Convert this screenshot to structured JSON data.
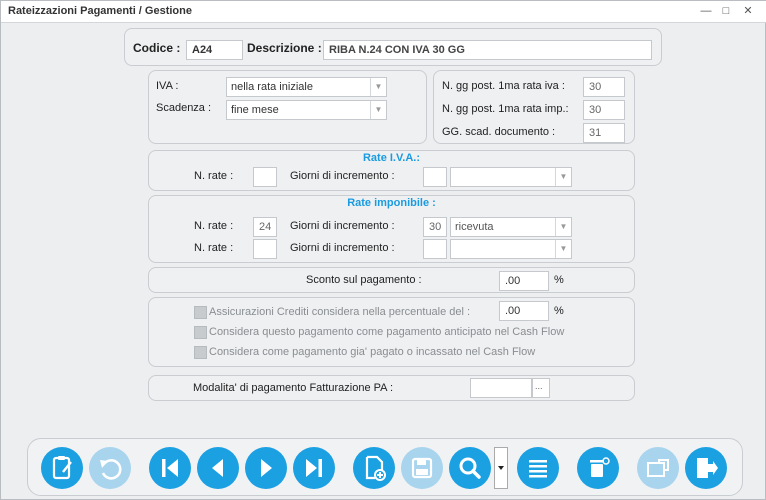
{
  "window": {
    "title": "Rateizzazioni Pagamenti / Gestione"
  },
  "header": {
    "codice_label": "Codice :",
    "codice_value": "A24",
    "descrizione_label": "Descrizione :",
    "descrizione_value": "RIBA N.24 CON IVA 30 GG"
  },
  "options": {
    "iva_label": "IVA :",
    "iva_value": "nella rata iniziale",
    "scadenza_label": "Scadenza :",
    "scadenza_value": "fine mese",
    "gg_post_iva_label": "N. gg post. 1ma rata iva :",
    "gg_post_iva_value": "30",
    "gg_post_imp_label": "N. gg post. 1ma rata imp.:",
    "gg_post_imp_value": "30",
    "gg_scad_label": "GG. scad. documento :",
    "gg_scad_value": "31"
  },
  "rate_iva": {
    "title": "Rate I.V.A.:",
    "n_rate_label": "N. rate :",
    "n_rate_value": "",
    "giorni_label": "Giorni  di incremento :",
    "giorni_value": "",
    "tipo_value": ""
  },
  "rate_imponibile": {
    "title": "Rate imponibile :",
    "rows": [
      {
        "n_rate_label": "N. rate :",
        "n_rate_value": "24",
        "giorni_label": "Giorni  di incremento :",
        "giorni_value": "30",
        "tipo_value": "ricevuta"
      },
      {
        "n_rate_label": "N. rate :",
        "n_rate_value": "",
        "giorni_label": "Giorni  di incremento :",
        "giorni_value": "",
        "tipo_value": ""
      }
    ]
  },
  "sconto": {
    "label": "Sconto sul pagamento :",
    "value": ".00",
    "unit": "%"
  },
  "assicurazioni": {
    "label": "Assicurazioni Crediti considera nella percentuale del :",
    "value": ".00",
    "unit": "%",
    "anticipato_label": "Considera questo pagamento come pagamento anticipato nel Cash Flow",
    "pagato_label": "Considera come pagamento gia' pagato o incassato nel Cash Flow"
  },
  "fatturazione": {
    "label": "Modalita' di pagamento Fatturazione PA :",
    "value": "",
    "ellipsis": "..."
  },
  "icons": {
    "new": "clipboard-edit-icon",
    "undo": "undo-icon",
    "first": "first-record-icon",
    "prev": "previous-record-icon",
    "next": "next-record-icon",
    "last": "last-record-icon",
    "copy": "copy-record-icon",
    "save": "save-icon",
    "search": "search-icon",
    "list": "list-icon",
    "delete": "delete-icon",
    "move": "move-icon",
    "exit": "exit-icon"
  },
  "colors": {
    "accent": "#1ba0e2",
    "accent_disabled": "#a8d4ee",
    "section_title": "#1a9be0"
  }
}
